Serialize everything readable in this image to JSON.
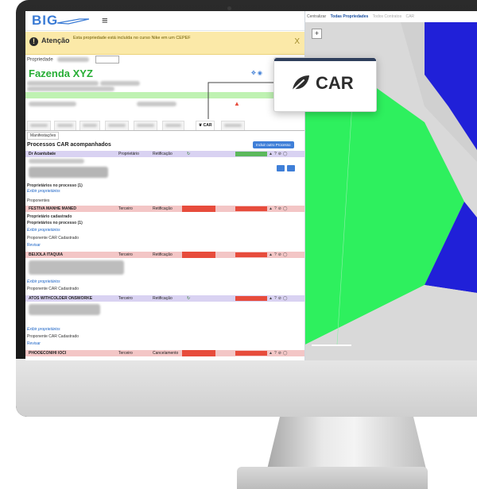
{
  "app": {
    "logo_text": "BIG",
    "alert": {
      "title": "Atenção",
      "message": "Esta propriedade está incluída no curso Nike em um CEPEF",
      "close": "X"
    },
    "property": {
      "label": "Propriedade",
      "name": "Fazenda XYZ"
    },
    "tabs": [
      "CAR"
    ],
    "subtab": "Manifestações",
    "processes": {
      "title": "Processos CAR acompanhados",
      "button": "Incluir outro Processo",
      "sections": [
        {
          "name": "Dr Acantubate",
          "col1": "Proprietário",
          "col2": "Retificação",
          "header_color": "#d9d2f2",
          "status_color": "#5cb85c"
        },
        {
          "name": "FESTIVA MANHE MANED",
          "col1": "Terceiro",
          "col2": "Retificação",
          "header_color": "#f3c6c6",
          "status_color": "#e74c3c"
        },
        {
          "name": "BEIJOLA ITAQUIA",
          "col1": "Terceiro",
          "col2": "Retificação",
          "header_color": "#f3c6c6",
          "status_color": "#e74c3c"
        },
        {
          "name": "ATOS WITHCOLDER ONSWORKE",
          "col1": "Terceiro",
          "col2": "Retificação",
          "header_color": "#d9d2f2",
          "status_color": "#d9d2f2"
        },
        {
          "name": "PHOOECONIHI IOCI",
          "col1": "Terceiro",
          "col2": "Cancelamento",
          "header_color": "#f3c6c6",
          "status_color": "#e74c3c"
        }
      ],
      "lines": {
        "owners_in_process": "Proprietários no processo (1)",
        "select_owners": "Exibir proprietários",
        "proposals": "Proponentes",
        "owner_registered": "Proprietário cadastrado",
        "owners_in_process2": "Proprietários no processo (1)",
        "car_cadastre": "Proponente CAR Cadastrado",
        "review": "Revisar"
      }
    }
  },
  "map": {
    "bar_items": [
      "Centralizar",
      "Todas Propriedades",
      "Todos Contratos",
      "CAR"
    ],
    "zoom_in": "+"
  },
  "callout": {
    "label": "CAR",
    "icon": "leaf-icon"
  },
  "colors": {
    "accent_blue": "#3f7fd8",
    "farm_green": "#27ae35",
    "map_green": "#2ef05e",
    "map_blue": "#2020d8",
    "alert_yellow": "#fbe9a8"
  }
}
